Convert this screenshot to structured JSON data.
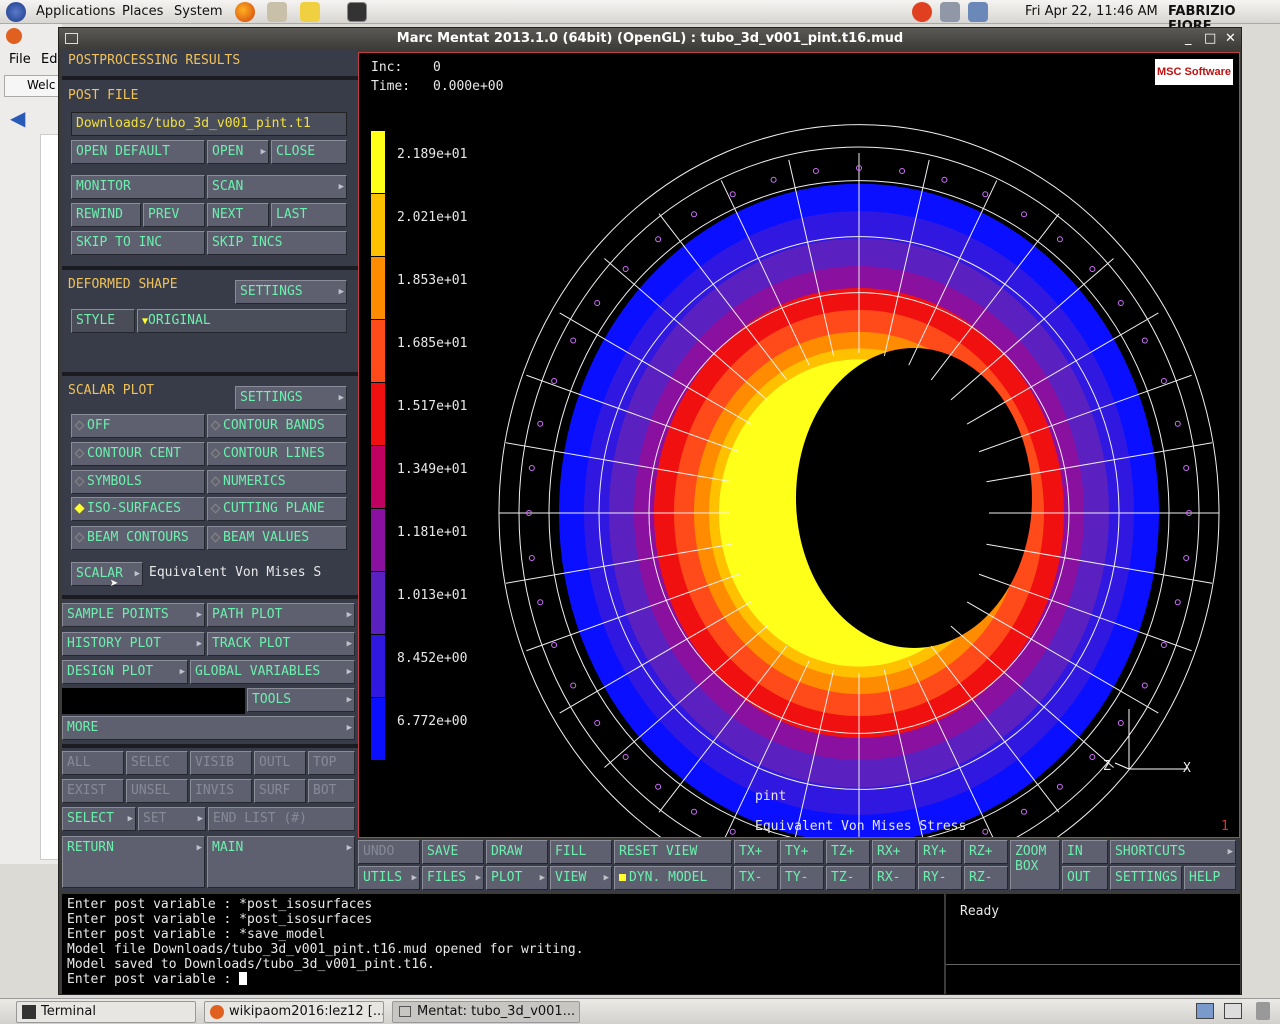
{
  "topbar": {
    "applications": "Applications",
    "places": "Places",
    "system": "System",
    "datetime": "Fri Apr 22, 11:46 AM",
    "user": "FABRIZIO FIORE"
  },
  "bgwin": {
    "menu_file": "File",
    "menu_edit": "Ed",
    "tab_label": "Welc"
  },
  "window": {
    "title": "Marc Mentat 2013.1.0 (64bit) (OpenGL) : tubo_3d_v001_pint.t16.mud"
  },
  "panel": {
    "postprocessing_header": "POSTPROCESSING RESULTS",
    "post_file_header": "POST FILE",
    "post_file_path": "Downloads/tubo_3d_v001_pint.t1",
    "open_default": "OPEN DEFAULT",
    "open": "OPEN",
    "close": "CLOSE",
    "monitor": "MONITOR",
    "scan": "SCAN",
    "rewind": "REWIND",
    "prev": "PREV",
    "next": "NEXT",
    "last": "LAST",
    "skip_to_inc": "SKIP TO INC",
    "skip_incs": "SKIP INCS",
    "deformed_header": "DEFORMED SHAPE",
    "deformed_settings": "SETTINGS",
    "style": "STYLE",
    "style_value": "ORIGINAL",
    "scalar_header": "SCALAR PLOT",
    "scalar_settings": "SETTINGS",
    "off": "OFF",
    "contour_bands": "CONTOUR BANDS",
    "contour_cent": "CONTOUR CENT",
    "contour_lines": "CONTOUR LINES",
    "symbols": "SYMBOLS",
    "numerics": "NUMERICS",
    "iso_surfaces": "ISO-SURFACES",
    "cutting_plane": "CUTTING PLANE",
    "beam_contours": "BEAM CONTOURS",
    "beam_values": "BEAM VALUES",
    "scalar": "SCALAR",
    "scalar_value": "Equivalent Von Mises S",
    "sample_points": "SAMPLE POINTS",
    "path_plot": "PATH PLOT",
    "history_plot": "HISTORY PLOT",
    "track_plot": "TRACK PLOT",
    "design_plot": "DESIGN PLOT",
    "global_variables": "GLOBAL VARIABLES",
    "tools": "TOOLS",
    "more": "MORE",
    "all": "ALL",
    "selec": "SELEC",
    "visib": "VISIB",
    "outl": "OUTL",
    "top": "TOP",
    "exist": "EXIST",
    "unsel": "UNSEL",
    "invis": "INVIS",
    "surf": "SURF",
    "bot": "BOT",
    "select": "SELECT",
    "set": "SET",
    "end_list": "END LIST (#)",
    "return": "RETURN",
    "main": "MAIN"
  },
  "view": {
    "inc_label": "Inc:",
    "inc_value": "0",
    "time_label": "Time:",
    "time_value": "0.000e+00",
    "msc_logo": "MSC Software",
    "legend": [
      "2.189e+01",
      "2.021e+01",
      "1.853e+01",
      "1.685e+01",
      "1.517e+01",
      "1.349e+01",
      "1.181e+01",
      "1.013e+01",
      "8.452e+00",
      "6.772e+00"
    ],
    "legend_colors": [
      "#ffff1a",
      "#ffc000",
      "#ff8c00",
      "#ff4a1a",
      "#f01010",
      "#c00060",
      "#8a10a0",
      "#5a20c0",
      "#3018e0",
      "#0a10ff"
    ],
    "node_label": "pint",
    "variable_label": "Equivalent Von Mises Stress",
    "frame_number": "1",
    "axis_z": "Z",
    "axis_x": "X"
  },
  "toolbar": {
    "undo": "UNDO",
    "save": "SAVE",
    "draw": "DRAW",
    "fill": "FILL",
    "reset_view": "RESET VIEW",
    "tx_plus": "TX+",
    "ty_plus": "TY+",
    "tz_plus": "TZ+",
    "rx_plus": "RX+",
    "ry_plus": "RY+",
    "rz_plus": "RZ+",
    "zoom_box": "ZOOM BOX",
    "in": "IN",
    "shortcuts": "SHORTCUTS",
    "utils": "UTILS",
    "files": "FILES",
    "plot": "PLOT",
    "view": "VIEW",
    "dyn_model": "DYN. MODEL",
    "tx_minus": "TX-",
    "ty_minus": "TY-",
    "tz_minus": "TZ-",
    "rx_minus": "RX-",
    "ry_minus": "RY-",
    "rz_minus": "RZ-",
    "out": "OUT",
    "settings": "SETTINGS",
    "help": "HELP"
  },
  "console": {
    "lines": [
      "Enter post variable : *post_isosurfaces",
      "Enter post variable : *post_isosurfaces",
      "Enter post variable : *save_model",
      "Model file Downloads/tubo_3d_v001_pint.t16.mud opened for writing.",
      "Model saved to Downloads/tubo_3d_v001_pint.t16.",
      "Enter post variable : "
    ]
  },
  "status": {
    "text": "Ready"
  },
  "taskbar": {
    "terminal": "Terminal",
    "browser": "wikipaom2016:lez12 [...",
    "mentat": "Mentat: tubo_3d_v001..."
  }
}
